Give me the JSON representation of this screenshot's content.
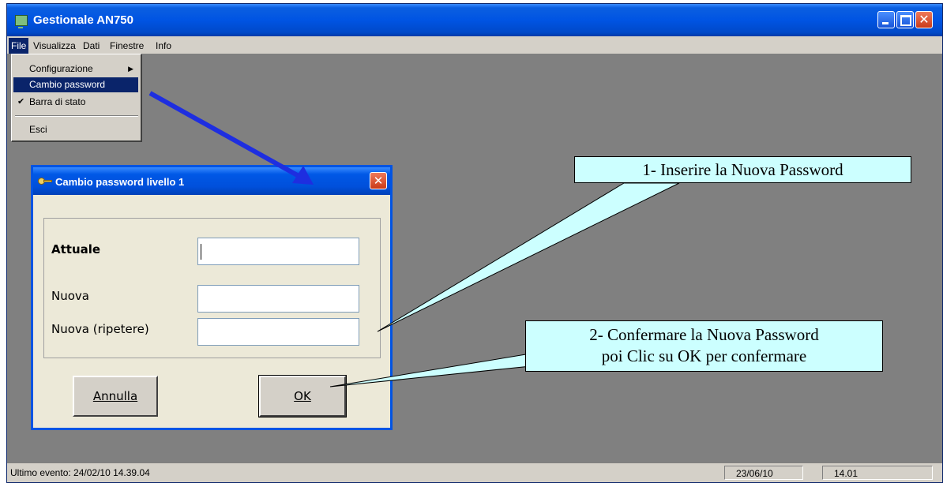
{
  "window": {
    "title": "Gestionale AN750"
  },
  "menubar": {
    "items": [
      "File",
      "Visualizza",
      "Dati",
      "Finestre",
      "Info"
    ]
  },
  "file_menu": {
    "items": [
      {
        "label": "Configurazione",
        "submenu": true
      },
      {
        "label": "Cambio password",
        "highlighted": true
      },
      {
        "label": "Barra di stato",
        "checked": true
      },
      {
        "label": "Esci"
      }
    ]
  },
  "dialog": {
    "title": "Cambio password livello 1",
    "labels": {
      "current": "Attuale",
      "new": "Nuova",
      "repeat": "Nuova (ripetere)"
    },
    "buttons": {
      "cancel": "Annulla",
      "ok": "OK"
    }
  },
  "statusbar": {
    "event": "Ultimo evento: 24/02/10 14.39.04",
    "date": "23/06/10",
    "time": "14.01"
  },
  "annotations": {
    "step1": "1- Inserire la Nuova Password",
    "step2_line1": "2- Confermare la Nuova Password",
    "step2_line2": "poi Clic su OK per confermare"
  },
  "colors": {
    "titlebar": "#0054e3",
    "desktop": "#808080",
    "callout_fill": "#ccffff",
    "arrow": "#1e2ee0"
  }
}
